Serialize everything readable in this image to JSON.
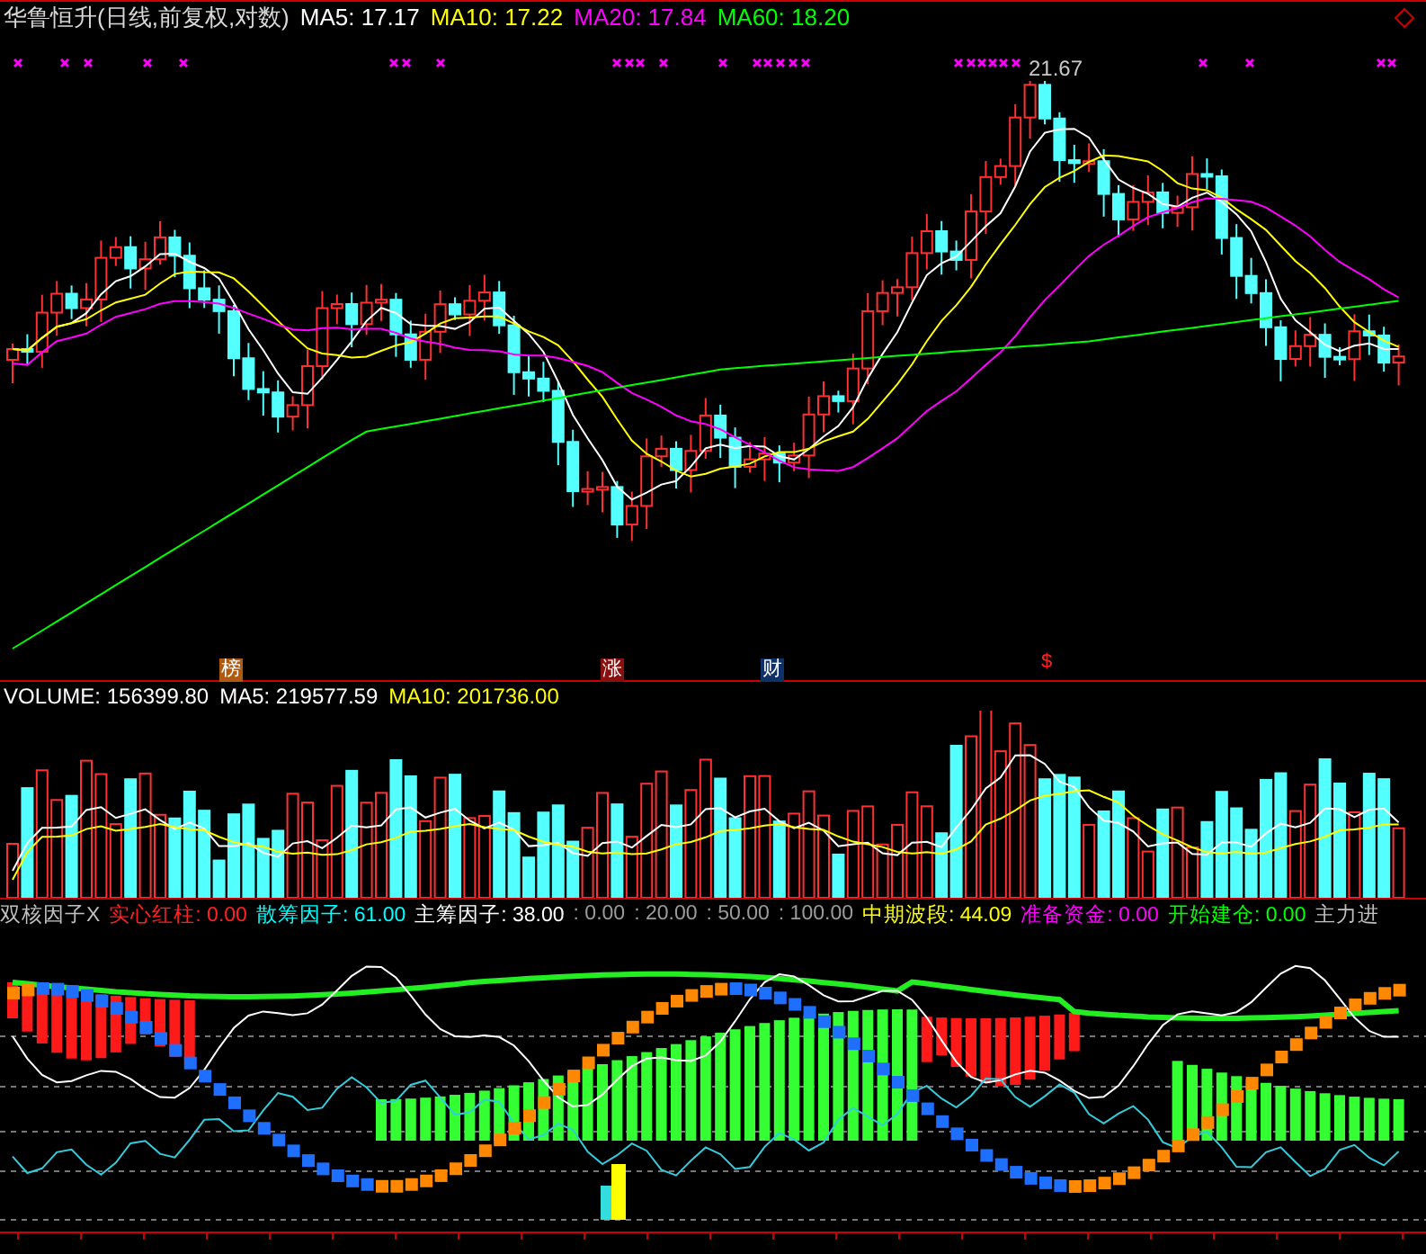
{
  "header": {
    "title": "华鲁恒升(日线,前复权,对数)",
    "ma": [
      {
        "label": "MA5: 17.17",
        "color": "#ffffff"
      },
      {
        "label": "MA10: 17.22",
        "color": "#ffff00"
      },
      {
        "label": "MA20: 17.84",
        "color": "#ff00ff"
      },
      {
        "label": "MA60: 18.20",
        "color": "#00ff00"
      }
    ]
  },
  "price_chart": {
    "peak_label": "21.67",
    "markers": [
      {
        "kind": "rank",
        "text": "榜"
      },
      {
        "kind": "rise",
        "text": "涨"
      },
      {
        "kind": "finance",
        "text": "财"
      },
      {
        "kind": "dollar",
        "text": "$"
      }
    ]
  },
  "volume": {
    "items": [
      {
        "label": "VOLUME: 156399.80",
        "color": "#ffffff"
      },
      {
        "label": "MA5: 219577.59",
        "color": "#ffffff"
      },
      {
        "label": "MA10: 201736.00",
        "color": "#ffff00"
      }
    ]
  },
  "indicator": {
    "title": "双核因子X",
    "items": [
      {
        "label": "实心红柱: 0.00",
        "color": "#ff2020"
      },
      {
        "label": "散筹因子: 61.00",
        "color": "#00ffff"
      },
      {
        "label": "主筹因子: 38.00",
        "color": "#ffffff"
      },
      {
        "label": ": 0.00",
        "color": "#9a9a9a"
      },
      {
        "label": ": 20.00",
        "color": "#9a9a9a"
      },
      {
        "label": ": 50.00",
        "color": "#9a9a9a"
      },
      {
        "label": ": 100.00",
        "color": "#9a9a9a"
      },
      {
        "label": "中期波段: 44.09",
        "color": "#ffff00"
      },
      {
        "label": "准备资金: 0.00",
        "color": "#ff00ff"
      },
      {
        "label": "开始建仓: 0.00",
        "color": "#00ff00"
      },
      {
        "label": "主力进",
        "color": "#c0c0c0"
      }
    ]
  }
}
